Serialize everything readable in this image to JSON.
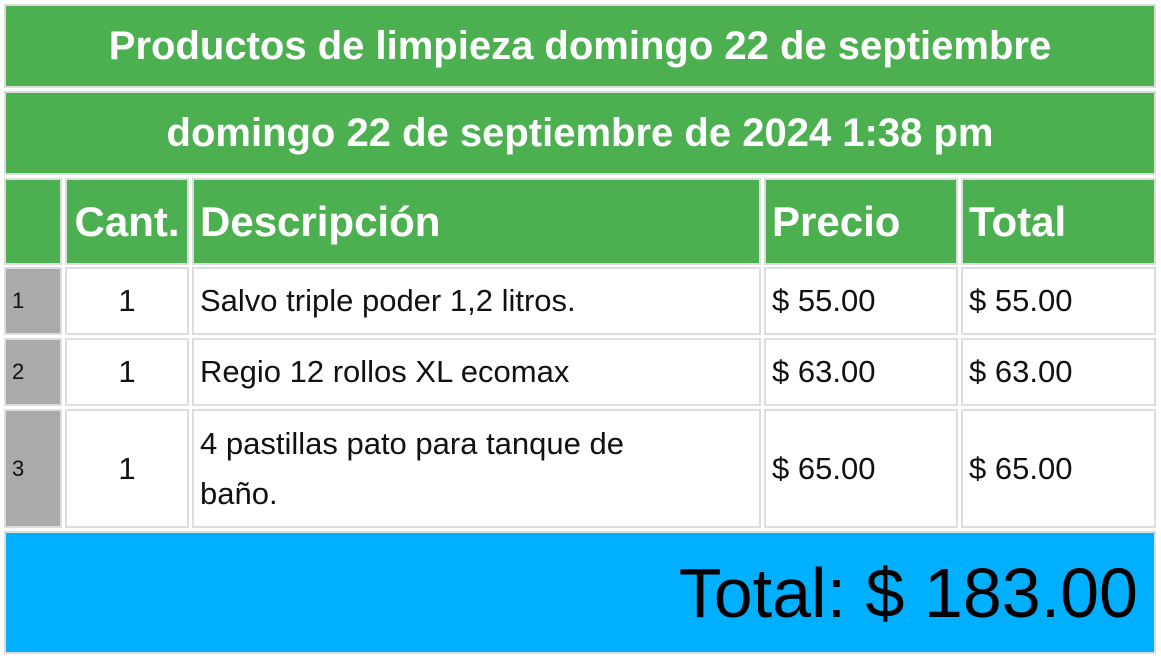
{
  "title": "Productos de limpieza domingo 22 de septiembre",
  "datetime": "domingo 22 de septiembre de 2024 1:38 pm",
  "headers": {
    "index": "",
    "quantity": "Cant.",
    "description": "Descripción",
    "price": "Precio",
    "total": "Total"
  },
  "rows": [
    {
      "index": "1",
      "quantity": "1",
      "description": "Salvo triple poder 1,2 litros.",
      "price": "$ 55.00",
      "total": "$ 55.00"
    },
    {
      "index": "2",
      "quantity": "1",
      "description": "Regio 12 rollos XL ecomax",
      "price": "$ 63.00",
      "total": "$ 63.00"
    },
    {
      "index": "3",
      "quantity": "1",
      "description": "4 pastillas pato para tanque de baño.",
      "price": "$ 65.00",
      "total": "$ 65.00"
    }
  ],
  "grand_total": "Total: $ 183.00",
  "colors": {
    "header_green": "#4caf50",
    "index_gray": "#aaaaaa",
    "total_blue": "#00b0ff"
  }
}
